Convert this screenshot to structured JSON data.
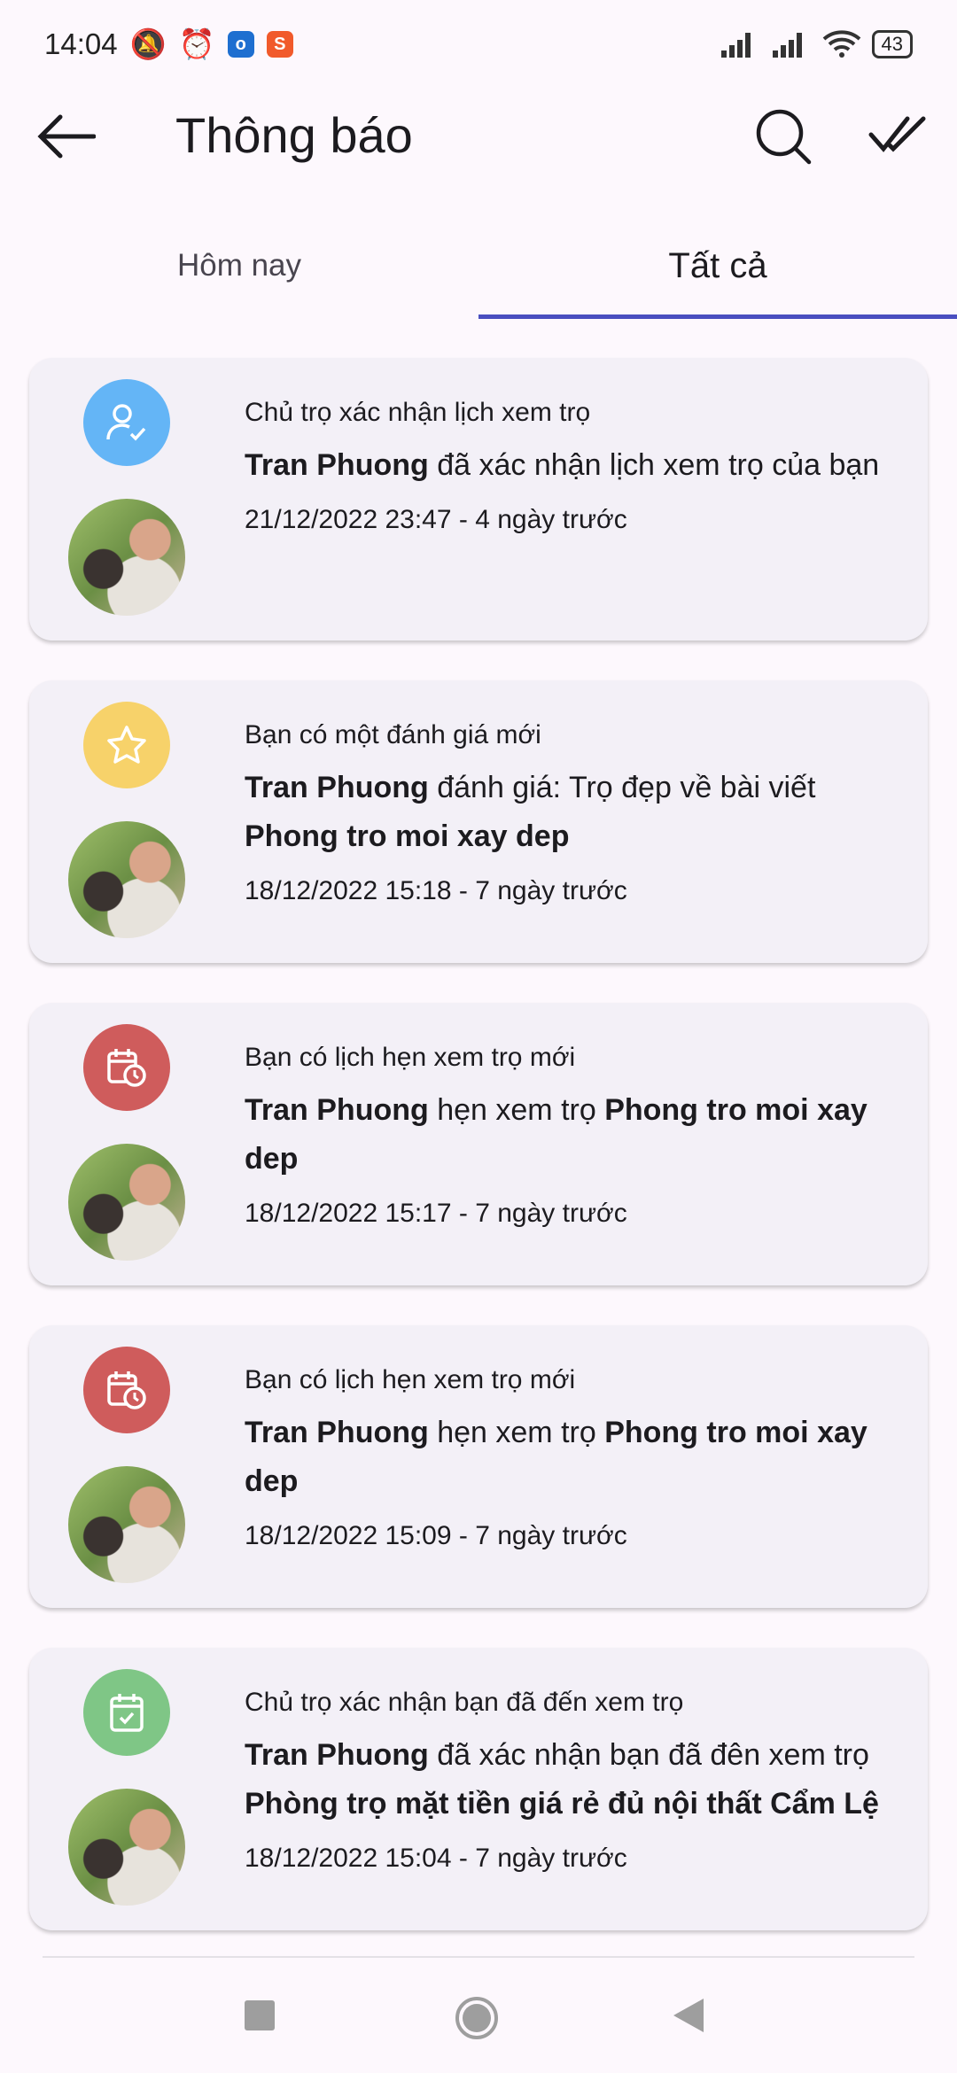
{
  "status_bar": {
    "time": "14:04",
    "battery": "43"
  },
  "app_bar": {
    "title": "Thông báo"
  },
  "tabs": [
    {
      "label": "Hôm nay"
    },
    {
      "label": "Tất cả"
    }
  ],
  "colors": {
    "accent": "#4a4fc0",
    "blue": "#64b5f6",
    "yellow": "#f7d26a",
    "red": "#cf5c5c",
    "green": "#7fc686"
  },
  "notifications": [
    {
      "icon": "user-check-icon",
      "heading": "Chủ trọ xác nhận lịch xem trọ",
      "name": "Tran Phuong",
      "text": " đã xác nhận lịch xem trọ của bạn",
      "post": "",
      "date": "21/12/2022 23:47 - 4 ngày trước"
    },
    {
      "icon": "star-icon",
      "heading": "Bạn có một đánh giá mới",
      "name": "Tran Phuong",
      "text": " đánh giá: Trọ đẹp  về bài viết ",
      "post": "Phong tro moi xay dep",
      "date": "18/12/2022 15:18 - 7 ngày trước"
    },
    {
      "icon": "calendar-clock-icon",
      "heading": "Bạn có lịch hẹn xem trọ mới",
      "name": "Tran Phuong",
      "text": " hẹn xem trọ ",
      "post": "Phong tro moi xay dep",
      "date": "18/12/2022 15:17 - 7 ngày trước"
    },
    {
      "icon": "calendar-clock-icon",
      "heading": "Bạn có lịch hẹn xem trọ mới",
      "name": "Tran Phuong",
      "text": " hẹn xem trọ ",
      "post": "Phong tro moi xay dep",
      "date": "18/12/2022 15:09 - 7 ngày trước"
    },
    {
      "icon": "calendar-check-icon",
      "heading": "Chủ trọ xác nhận bạn đã đến xem trọ",
      "name": "Tran Phuong",
      "text": " đã xác nhận bạn đã đên xem trọ ",
      "post": "Phòng trọ mặt tiền giá rẻ đủ nội thất Cẩm Lệ",
      "date": "18/12/2022 15:04 - 7 ngày trước"
    }
  ]
}
